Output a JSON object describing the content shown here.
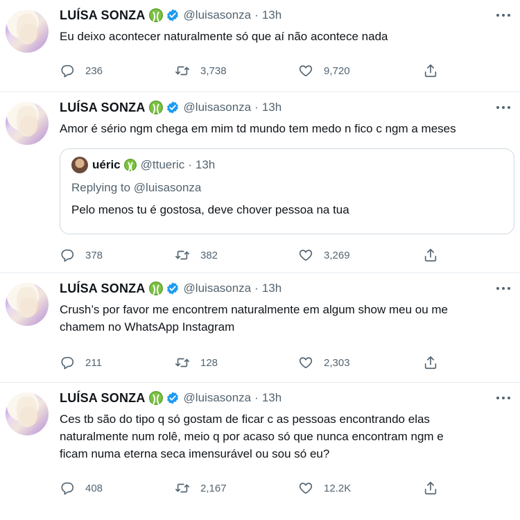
{
  "tweets": [
    {
      "name": "LUÍSA SONZA",
      "handle": "@luisasonza",
      "separator": "·",
      "time": "13h",
      "text": "Eu deixo acontecer naturalmente só que aí não acontece nada",
      "replies": "236",
      "retweets": "3,738",
      "likes": "9,720"
    },
    {
      "name": "LUÍSA SONZA",
      "handle": "@luisasonza",
      "separator": "·",
      "time": "13h",
      "text": "Amor é sério ngm chega em mim td mundo tem medo n fico c ngm a meses",
      "quote": {
        "name": "uéric",
        "handle": "@ttueric",
        "separator": "·",
        "time": "13h",
        "replying_label": "Replying to",
        "replying_to": "@luisasonza",
        "text": "Pelo menos tu é gostosa, deve chover pessoa na tua"
      },
      "replies": "378",
      "retweets": "382",
      "likes": "3,269"
    },
    {
      "name": "LUÍSA SONZA",
      "handle": "@luisasonza",
      "separator": "·",
      "time": "13h",
      "text_lines": [
        "Crush’s por favor me encontrem naturalmente em algum show meu ou me",
        "chamem no WhatsApp Instagram"
      ],
      "replies": "211",
      "retweets": "128",
      "likes": "2,303"
    },
    {
      "name": "LUÍSA SONZA",
      "handle": "@luisasonza",
      "separator": "·",
      "time": "13h",
      "text_lines": [
        "Ces tb são do tipo q só gostam de ficar c as pessoas encontrando elas",
        "naturalmente num rolê, meio q por acaso só que nunca encontram ngm e",
        "ficam numa eterna seca imensurável ou sou só eu?"
      ],
      "replies": "408",
      "retweets": "2,167",
      "likes": "12.2K"
    }
  ],
  "icons": {
    "reply": "reply-icon",
    "retweet": "retweet-icon",
    "like": "heart-icon",
    "share": "share-icon",
    "verified": "verified-badge-icon",
    "emoji": "tennis-ball-icon",
    "more": "more-options-icon"
  },
  "colors": {
    "text": "#0f1419",
    "muted": "#536471",
    "verified": "#1d9bf0",
    "border": "#e6ecf0",
    "tennis": "#7bc142"
  }
}
